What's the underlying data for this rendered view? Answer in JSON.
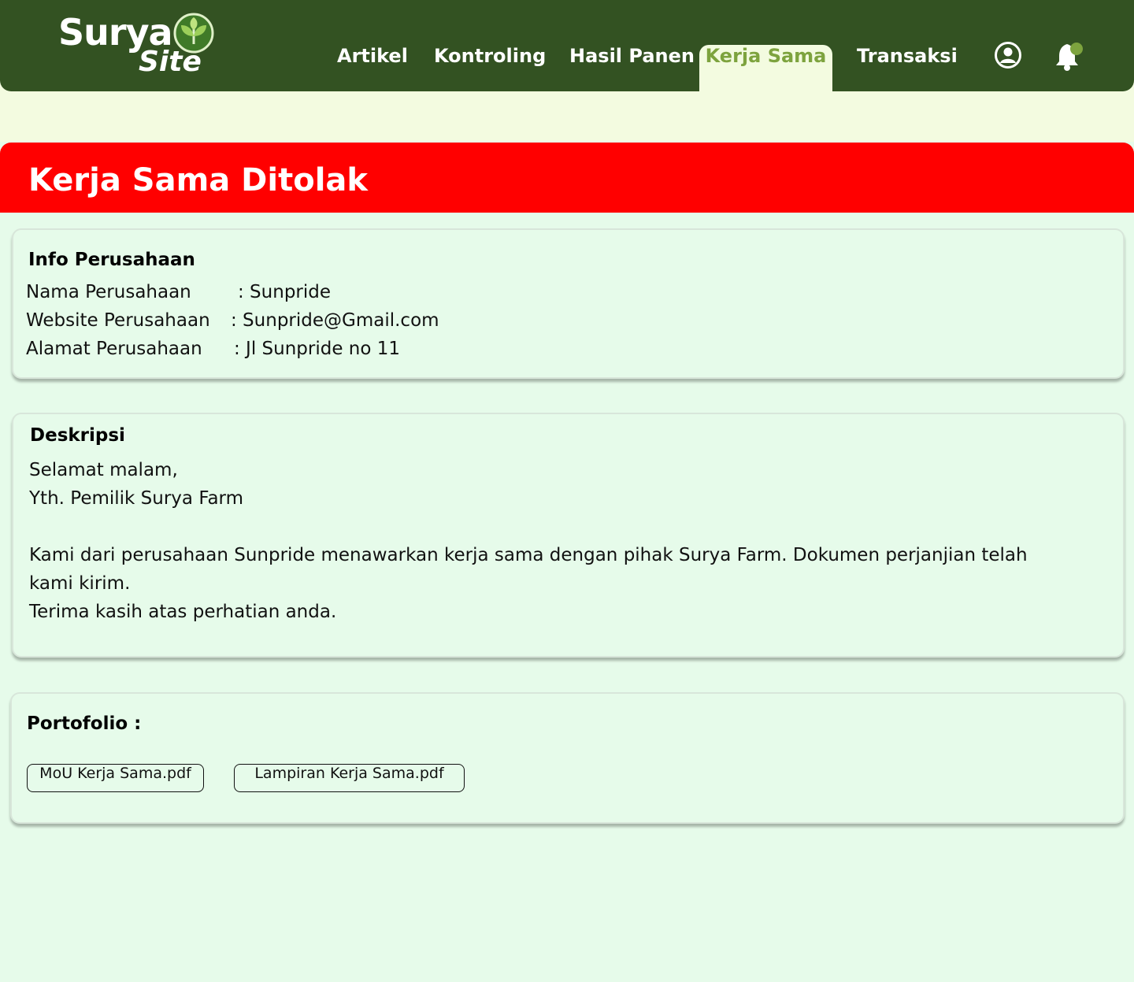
{
  "logo": {
    "word1": "Surya",
    "word2": "Site"
  },
  "nav": {
    "items": [
      {
        "label": "Artikel"
      },
      {
        "label": "Kontroling"
      },
      {
        "label": "Hasil Panen"
      },
      {
        "label": "Kerja Sama",
        "active": true
      },
      {
        "label": "Transaksi"
      }
    ],
    "icons": [
      "user-circle-icon",
      "bell-icon"
    ]
  },
  "colors": {
    "navbar": "#335222",
    "active_tab_text": "#7da33e",
    "banner": "#ff0000",
    "page_bg": "#e6fbea",
    "notification_dot": "#7da33e"
  },
  "banner": {
    "title": "Kerja Sama Ditolak"
  },
  "info": {
    "heading": "Info Perusahaan",
    "rows": [
      {
        "label": "Nama Perusahaan",
        "value": ": Sunpride"
      },
      {
        "label": "Website Perusahaan",
        "value": ": Sunpride@Gmail.com"
      },
      {
        "label": "Alamat Perusahaan",
        "value": ": Jl Sunpride no 11"
      }
    ]
  },
  "description": {
    "heading": "Deskripsi",
    "lines": [
      "Selamat malam,",
      "Yth. Pemilik Surya Farm",
      "Kami dari perusahaan Sunpride menawarkan kerja sama dengan pihak Surya Farm. Dokumen perjanjian telah",
      "kami kirim.",
      "Terima kasih atas perhatian anda."
    ]
  },
  "portfolio": {
    "heading": "Portofolio :",
    "files": [
      "MoU Kerja Sama.pdf",
      "Lampiran Kerja Sama.pdf"
    ]
  }
}
